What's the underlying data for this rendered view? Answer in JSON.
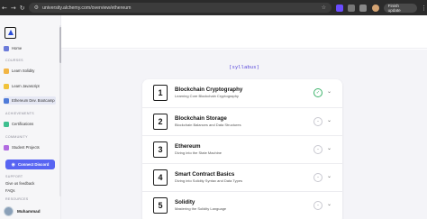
{
  "browser": {
    "url": "university.alchemy.com/overview/ethereum",
    "finish_update": "Finish update"
  },
  "sidebar": {
    "home": "Home",
    "courses_heading": "COURSES",
    "courses": [
      {
        "label": "Learn Solidity",
        "color": "#f2b544"
      },
      {
        "label": "Learn Javascript",
        "color": "#f0c23a"
      },
      {
        "label": "Ethereum Dev. Bootcamp",
        "color": "#4f7bd8"
      }
    ],
    "achievements_heading": "ACHIEVEMENTS",
    "certifications": "Certifications",
    "community_heading": "COMMUNITY",
    "student_projects": "Student Projects",
    "connect_discord": "Connect Discord",
    "support_heading": "SUPPORT",
    "give_feedback": "Give us feedback",
    "faqs": "FAQs",
    "resources_heading": "RESOURCES",
    "user_name": "Muhammad"
  },
  "main": {
    "syllabus_label": "[syllabus]",
    "modules": [
      {
        "number": "1",
        "title": "Blockchain Cryptography",
        "subtitle": "Learning Core Blockchain Cryptography",
        "status": "completed"
      },
      {
        "number": "2",
        "title": "Blockchain Storage",
        "subtitle": "Blockchain Balances and Data Structures",
        "status": "incomplete"
      },
      {
        "number": "3",
        "title": "Ethereum",
        "subtitle": "Diving into the State Machine",
        "status": "incomplete"
      },
      {
        "number": "4",
        "title": "Smart Contract Basics",
        "subtitle": "Diving into Solidity Syntax and Data Types",
        "status": "incomplete"
      },
      {
        "number": "5",
        "title": "Solidity",
        "subtitle": "Mastering the Solidity Language",
        "status": "incomplete"
      }
    ]
  },
  "colors": {
    "accent": "#5b4bdb",
    "discord": "#5865f2",
    "complete": "#3bb36a"
  }
}
